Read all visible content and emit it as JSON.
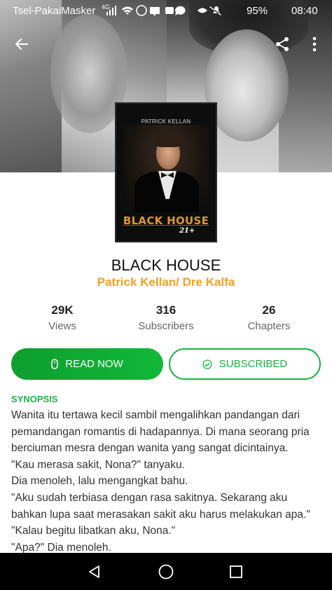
{
  "status_bar": {
    "carrier": "Tsel-PakaiMasker",
    "network": "4G",
    "battery": "95%",
    "time": "08:40"
  },
  "icons": {
    "back": "arrow-left-icon",
    "share": "share-icon",
    "more": "more-vertical-icon",
    "read": "mouse-icon",
    "subscribed": "check-circle-icon",
    "nav_back": "triangle-back-icon",
    "nav_home": "circle-home-icon",
    "nav_recent": "square-recent-icon"
  },
  "cover": {
    "author": "PATRICK KELLAN",
    "title": "BLACK HOUSE",
    "age_rating": "21+"
  },
  "book": {
    "title": "BLACK HOUSE",
    "author": "Patrick Kellan/ Dre Kalfa"
  },
  "stats": [
    {
      "value": "29K",
      "label": "Views"
    },
    {
      "value": "316",
      "label": "Subscribers"
    },
    {
      "value": "26",
      "label": "Chapters"
    }
  ],
  "actions": {
    "read_label": "READ NOW",
    "subscribed_label": "SUBSCRIBED"
  },
  "synopsis": {
    "heading": "SYNOPSIS",
    "lines": [
      "Wanita itu tertawa kecil sambil mengalihkan pandangan dari",
      "pemandangan romantis di hadapannya. Di mana seorang pria",
      "berciuman mesra dengan wanita yang sangat dicintainya.",
      "\"Kau merasa sakit, Nona?\" tanyaku.",
      "Dia menoleh, lalu mengangkat bahu.",
      "\"Aku sudah terbiasa dengan rasa sakitnya. Sekarang aku",
      "bahkan lupa saat merasakan sakit aku harus melakukan apa.\"",
      "\"Kalau begitu libatkan aku, Nona.\"",
      "\"Apa?\" Dia menoleh."
    ]
  },
  "colors": {
    "accent_green": "#18b33f",
    "author_orange": "#f2a024"
  }
}
